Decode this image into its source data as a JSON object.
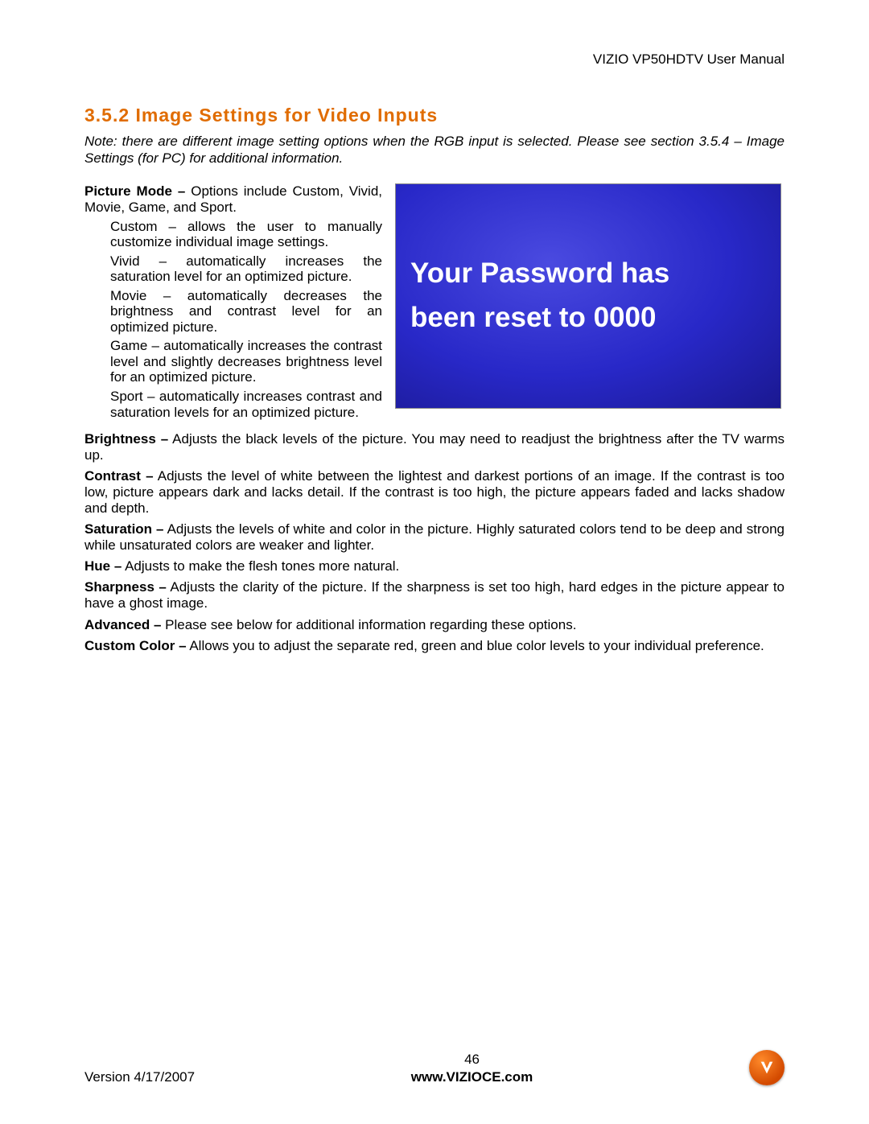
{
  "header": {
    "doc_title": "VIZIO VP50HDTV User Manual"
  },
  "section": {
    "number": "3.5.2",
    "title": "Image Settings for Video Inputs",
    "note": "Note: there are different image setting options when the RGB input is selected.  Please see section 3.5.4 – Image Settings (for PC) for additional information."
  },
  "picture_mode": {
    "label": "Picture Mode –",
    "intro": " Options include Custom, Vivid, Movie, Game, and Sport.",
    "items": [
      "Custom – allows the user to manually customize individual image settings.",
      "Vivid – automatically increases the saturation level for an optimized picture.",
      "Movie – automatically decreases the brightness and contrast level for an optimized picture.",
      "Game – automatically increases the contrast level and slightly decreases brightness level for an optimized picture.",
      "Sport – automatically increases contrast and saturation levels for an optimized picture."
    ]
  },
  "blue_screen": {
    "line1": "Your Password has",
    "line2": "been reset to 0000"
  },
  "paragraphs": [
    {
      "label": "Brightness –",
      "text": " Adjusts the black levels of the picture.  You may need to readjust the brightness after the TV warms up."
    },
    {
      "label": "Contrast –",
      "text": " Adjusts the level of white between the lightest and darkest portions of an image.  If the contrast is too low, picture appears dark and lacks detail.  If the contrast is too high, the picture appears faded and lacks shadow and depth."
    },
    {
      "label": "Saturation –",
      "text": " Adjusts the levels of white and color in the picture.  Highly saturated colors tend to be deep and strong while unsaturated colors are weaker and lighter."
    },
    {
      "label": "Hue –",
      "text": " Adjusts to make the flesh tones more natural."
    },
    {
      "label": "Sharpness –",
      "text": " Adjusts the clarity of the picture.  If the sharpness is set too high, hard edges in the picture appear to have a ghost image."
    },
    {
      "label": "Advanced –",
      "text": " Please see below for additional information regarding these options."
    },
    {
      "label": "Custom Color –",
      "text": " Allows you to adjust the separate red, green and blue color levels to your individual preference."
    }
  ],
  "footer": {
    "version": "Version 4/17/2007",
    "page": "46",
    "url": "www.VIZIOCE.com"
  }
}
